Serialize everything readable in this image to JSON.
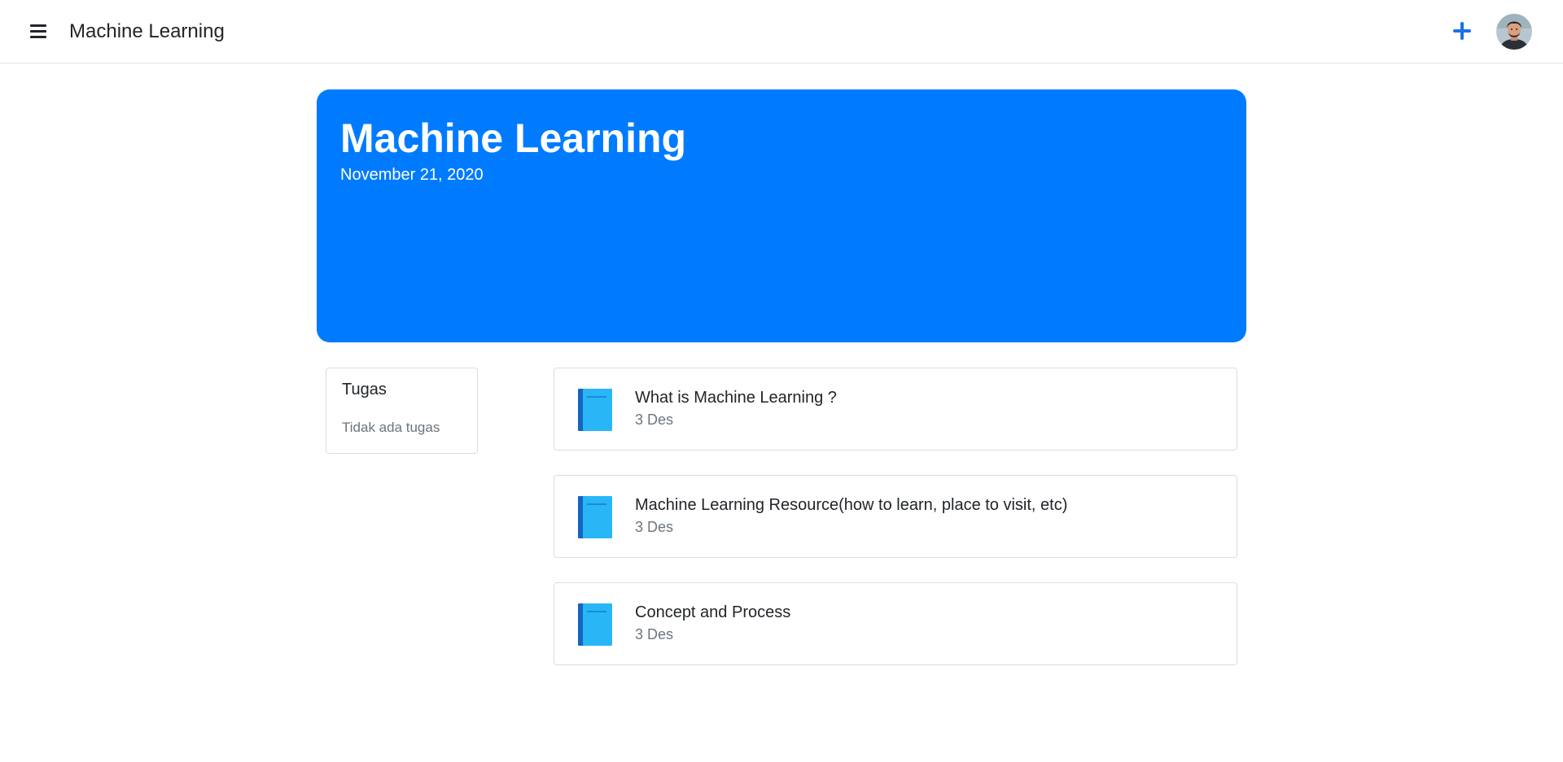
{
  "header": {
    "title": "Machine Learning",
    "menu_icon": "hamburger-menu-icon",
    "add_icon": "plus-icon",
    "accent_color": "#1a73e8"
  },
  "banner": {
    "title": "Machine Learning",
    "date": "November 21, 2020",
    "background_color": "#007bff"
  },
  "tugas": {
    "title": "Tugas",
    "empty_text": "Tidak ada tugas"
  },
  "materials": [
    {
      "title": "What is Machine Learning ?",
      "date": "3 Des",
      "icon": "book-icon"
    },
    {
      "title": "Machine Learning Resource(how to learn, place to visit, etc)",
      "date": "3 Des",
      "icon": "book-icon"
    },
    {
      "title": "Concept and Process",
      "date": "3 Des",
      "icon": "book-icon"
    }
  ]
}
